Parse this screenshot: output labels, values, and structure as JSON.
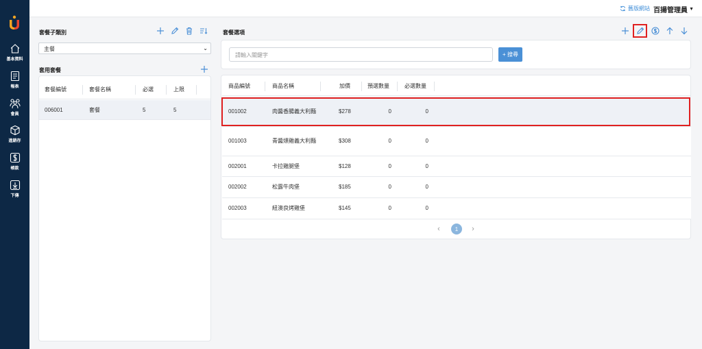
{
  "sidebar": {
    "items": [
      {
        "label": "基本資料",
        "icon": "home-icon"
      },
      {
        "label": "報表",
        "icon": "report-icon"
      },
      {
        "label": "會員",
        "icon": "members-icon"
      },
      {
        "label": "進銷存",
        "icon": "inventory-box-icon"
      },
      {
        "label": "帳款",
        "icon": "dollar-icon"
      },
      {
        "label": "下傳",
        "icon": "download-icon"
      }
    ]
  },
  "topbar": {
    "old_site": "舊版網站",
    "admin": "百揚管理員"
  },
  "left": {
    "category_title": "套餐子類別",
    "category_selected": "主餐",
    "combos_title": "套用套餐",
    "columns": [
      "套餐編號",
      "套餐名稱",
      "必選",
      "上限"
    ],
    "rows": [
      {
        "code": "006001",
        "name": "套餐",
        "required": "5",
        "limit": "5"
      }
    ]
  },
  "right": {
    "title": "套餐選項",
    "search_placeholder": "請輸入關鍵字",
    "search_button": "+ 搜尋",
    "columns": [
      "商品編號",
      "商品名稱",
      "加價",
      "預選數量",
      "必選數量"
    ],
    "rows": [
      {
        "code": "001002",
        "name": "肉醬香腸義大利麵",
        "price": "$278",
        "preselect": "0",
        "required": "0"
      },
      {
        "code": "001003",
        "name": "青醬燻雞義大利麵",
        "price": "$308",
        "preselect": "0",
        "required": "0"
      },
      {
        "code": "002001",
        "name": "卡拉雞腿堡",
        "price": "$128",
        "preselect": "0",
        "required": "0"
      },
      {
        "code": "002002",
        "name": "松露牛肉堡",
        "price": "$185",
        "preselect": "0",
        "required": "0"
      },
      {
        "code": "002003",
        "name": "紐澳良烤雞堡",
        "price": "$145",
        "preselect": "0",
        "required": "0"
      }
    ],
    "page": "1"
  },
  "colors": {
    "sidebar": "#0d2845",
    "accent": "#4a90d6",
    "highlight": "#e02020"
  }
}
